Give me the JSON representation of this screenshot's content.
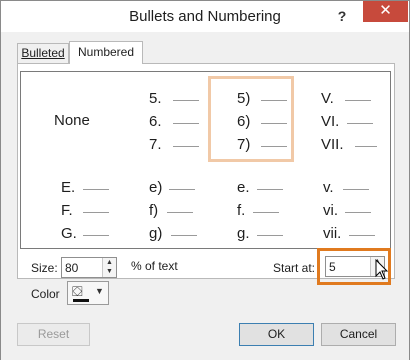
{
  "dialog": {
    "title": "Bullets and Numbering",
    "help_glyph": "?",
    "close_glyph": "✕"
  },
  "tabs": [
    {
      "label": "Bulleted",
      "selected": false
    },
    {
      "label": "Numbered",
      "selected": true
    }
  ],
  "none_label": "None",
  "gallery": {
    "col1": [
      "5.",
      "6.",
      "7."
    ],
    "col2": [
      "5)",
      "6)",
      "7)"
    ],
    "col3": [
      "V.",
      "VI.",
      "VII."
    ],
    "row2_col0": [
      "E.",
      "F.",
      "G."
    ],
    "row2_col1": [
      "e)",
      "f)",
      "g)"
    ],
    "row2_col2": [
      "e.",
      "f.",
      "g."
    ],
    "row2_col3": [
      "v.",
      "vi.",
      "vii."
    ],
    "selected": "5)"
  },
  "size": {
    "label": "Size:",
    "value": "80",
    "unit_label": "% of text"
  },
  "color": {
    "label": "Color"
  },
  "start_at": {
    "label": "Start at:",
    "value": "5"
  },
  "buttons": {
    "reset": "Reset",
    "ok": "OK",
    "cancel": "Cancel"
  },
  "accent_colors": {
    "highlight": "#e07a1f",
    "selection": "#f1c9a7",
    "close": "#c74a3c"
  }
}
